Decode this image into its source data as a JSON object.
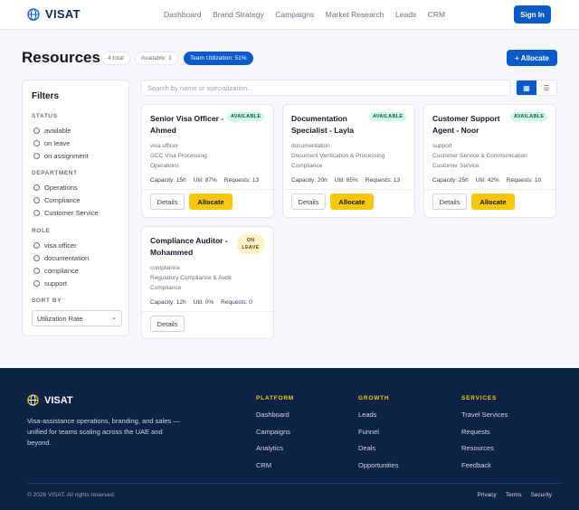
{
  "header": {
    "brand": "VISAT",
    "nav": [
      "Dashboard",
      "Brand Strategy",
      "Campaigns",
      "Market Research",
      "Leads",
      "CRM"
    ],
    "sign_in": "Sign In"
  },
  "page": {
    "title": "Resources",
    "pills": {
      "total": "4 total",
      "available": "Available: 3",
      "utilization": "Team Utilization: 51%"
    },
    "allocate": "+ Allocate"
  },
  "filters": {
    "title": "Filters",
    "status": {
      "label": "STATUS",
      "options": [
        "available",
        "on leave",
        "on assignment"
      ]
    },
    "department": {
      "label": "DEPARTMENT",
      "options": [
        "Operations",
        "Compliance",
        "Customer Service"
      ]
    },
    "role": {
      "label": "ROLE",
      "options": [
        "visa officer",
        "documentation",
        "compliance",
        "support"
      ]
    },
    "sort": {
      "label": "SORT BY",
      "value": "Utilization Rate"
    }
  },
  "search": {
    "placeholder": "Search by name or specialization..."
  },
  "view_toggle": {
    "grid_icon": "grid-icon",
    "list_icon": "list-icon"
  },
  "cards": [
    {
      "name": "Senior Visa Officer - Ahmed",
      "badge": "AVAILABLE",
      "role": "visa officer",
      "spec": "GCC Visa Processing",
      "dept": "Operations",
      "capacity": "Capacity: 15h",
      "util": "Util: 87%",
      "requests": "Requests: 13",
      "details": "Details",
      "allocate": "Allocate"
    },
    {
      "name": "Documentation Specialist - Layla",
      "badge": "AVAILABLE",
      "role": "documentation",
      "spec": "Document Verification & Processing",
      "dept": "Compliance",
      "capacity": "Capacity: 20h",
      "util": "Util: 65%",
      "requests": "Requests: 13",
      "details": "Details",
      "allocate": "Allocate"
    },
    {
      "name": "Customer Support Agent - Noor",
      "badge": "AVAILABLE",
      "role": "support",
      "spec": "Customer Service & Communication",
      "dept": "Customer Service",
      "capacity": "Capacity: 25h",
      "util": "Util: 42%",
      "requests": "Requests: 10",
      "details": "Details",
      "allocate": "Allocate"
    },
    {
      "name": "Compliance Auditor - Mohammed",
      "badge": "ON LEAVE",
      "role": "compliance",
      "spec": "Regulatory Compliance & Audit",
      "dept": "Compliance",
      "capacity": "Capacity: 12h",
      "util": "Util: 0%",
      "requests": "Requests: 0",
      "details": "Details"
    }
  ],
  "footer": {
    "brand": "VISAT",
    "tagline": "Visa-assistance operations, branding, and sales — unified for teams scaling across the UAE and beyond.",
    "platform": {
      "title": "PLATFORM",
      "links": [
        "Dashboard",
        "Campaigns",
        "Analytics",
        "CRM"
      ]
    },
    "growth": {
      "title": "GROWTH",
      "links": [
        "Leads",
        "Funnel",
        "Deals",
        "Opportunities"
      ]
    },
    "services": {
      "title": "SERVICES",
      "links": [
        "Travel Services",
        "Requests",
        "Resources",
        "Feedback"
      ]
    },
    "copyright": "© 2026 VISAT. All rights reserved.",
    "legal": [
      "Privacy",
      "Terms",
      "Security"
    ]
  },
  "colors": {
    "primary": "#0b5ac9",
    "accent": "#f9c80e",
    "footer_bg": "#0d2346"
  }
}
